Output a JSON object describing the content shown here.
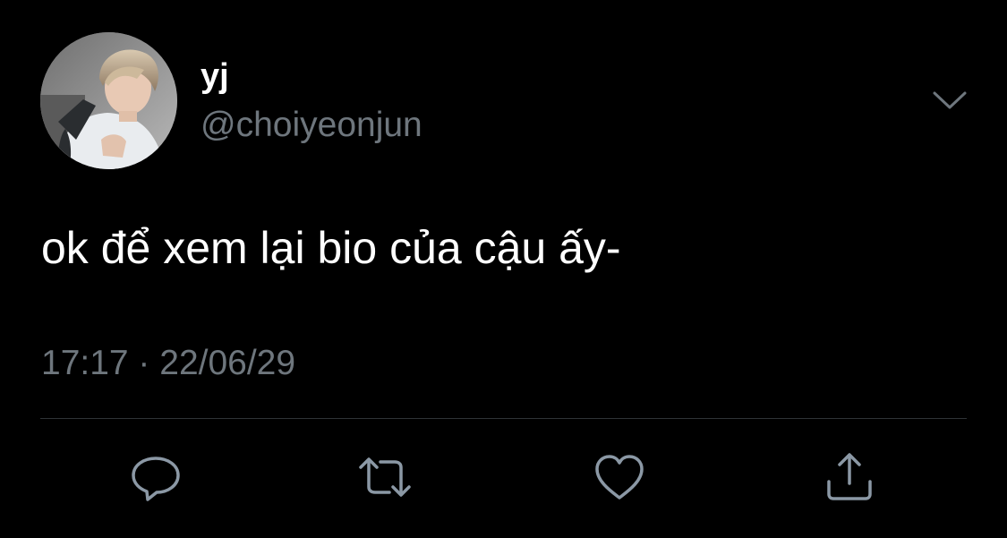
{
  "tweet": {
    "display_name": "yj",
    "handle": "@choiyeonjun",
    "text": "ok để xem lại bio của cậu ấy-",
    "timestamp": "17:17 · 22/06/29"
  },
  "icons": {
    "more": "chevron-down-icon",
    "reply": "reply-icon",
    "retweet": "retweet-icon",
    "like": "heart-icon",
    "share": "share-icon"
  },
  "colors": {
    "background": "#000000",
    "primary_text": "#ffffff",
    "secondary_text": "#6e767d",
    "icon": "#8b98a5",
    "divider": "#2f3336"
  }
}
